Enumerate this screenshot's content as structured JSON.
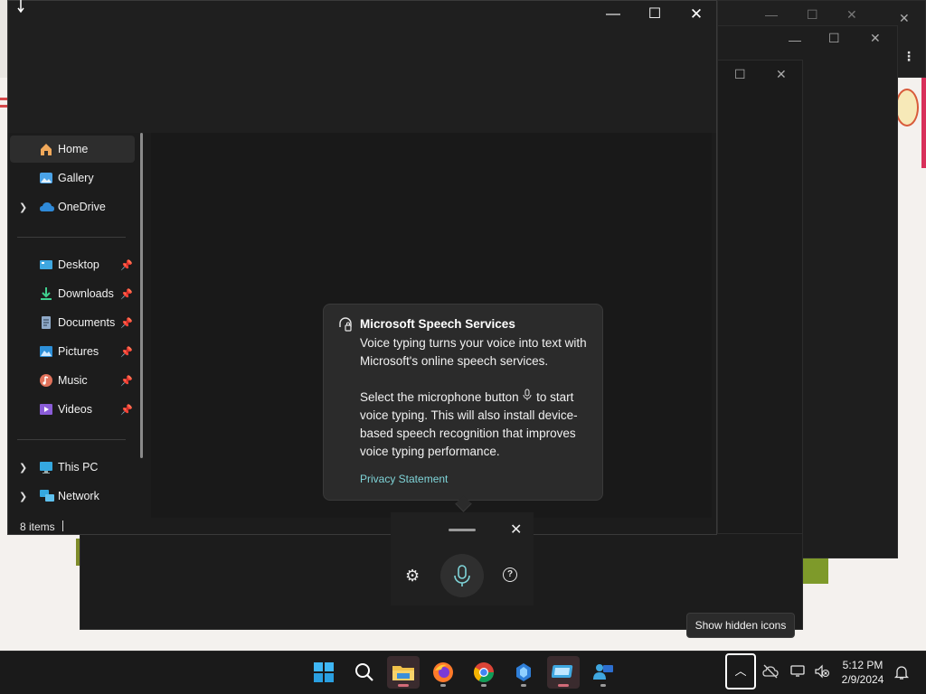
{
  "explorer": {
    "nav_items": [
      {
        "label": "Home",
        "icon": "home-icon",
        "pinned": false,
        "expandable": false,
        "active": true
      },
      {
        "label": "Gallery",
        "icon": "gallery-icon",
        "pinned": false,
        "expandable": false
      },
      {
        "label": "OneDrive",
        "icon": "onedrive-icon",
        "pinned": false,
        "expandable": true
      },
      {
        "label": "Desktop",
        "icon": "desktop-icon",
        "pinned": true,
        "expandable": false
      },
      {
        "label": "Downloads",
        "icon": "downloads-icon",
        "pinned": true,
        "expandable": false
      },
      {
        "label": "Documents",
        "icon": "documents-icon",
        "pinned": true,
        "expandable": false
      },
      {
        "label": "Pictures",
        "icon": "pictures-icon",
        "pinned": true,
        "expandable": false
      },
      {
        "label": "Music",
        "icon": "music-icon",
        "pinned": true,
        "expandable": false
      },
      {
        "label": "Videos",
        "icon": "videos-icon",
        "pinned": true,
        "expandable": false
      },
      {
        "label": "This PC",
        "icon": "this-pc-icon",
        "pinned": false,
        "expandable": true
      },
      {
        "label": "Network",
        "icon": "network-icon",
        "pinned": false,
        "expandable": true
      }
    ],
    "status": "8 items"
  },
  "speech_popup": {
    "title": "Microsoft Speech Services",
    "paragraph1": "Voice typing turns your voice into text with Microsoft's online speech services.",
    "paragraph2_before": "Select the microphone button",
    "paragraph2_after": "to start voice typing. This will also install device-based speech recognition that improves voice typing performance.",
    "link": "Privacy Statement"
  },
  "tooltip": "Show hidden icons",
  "clock": {
    "time": "5:12 PM",
    "date": "2/9/2024"
  },
  "taskbar_apps": [
    "start-icon",
    "search-icon",
    "file-explorer-icon",
    "firefox-icon",
    "chrome-icon",
    "app-icon",
    "remote-desktop-icon",
    "teams-icon"
  ]
}
